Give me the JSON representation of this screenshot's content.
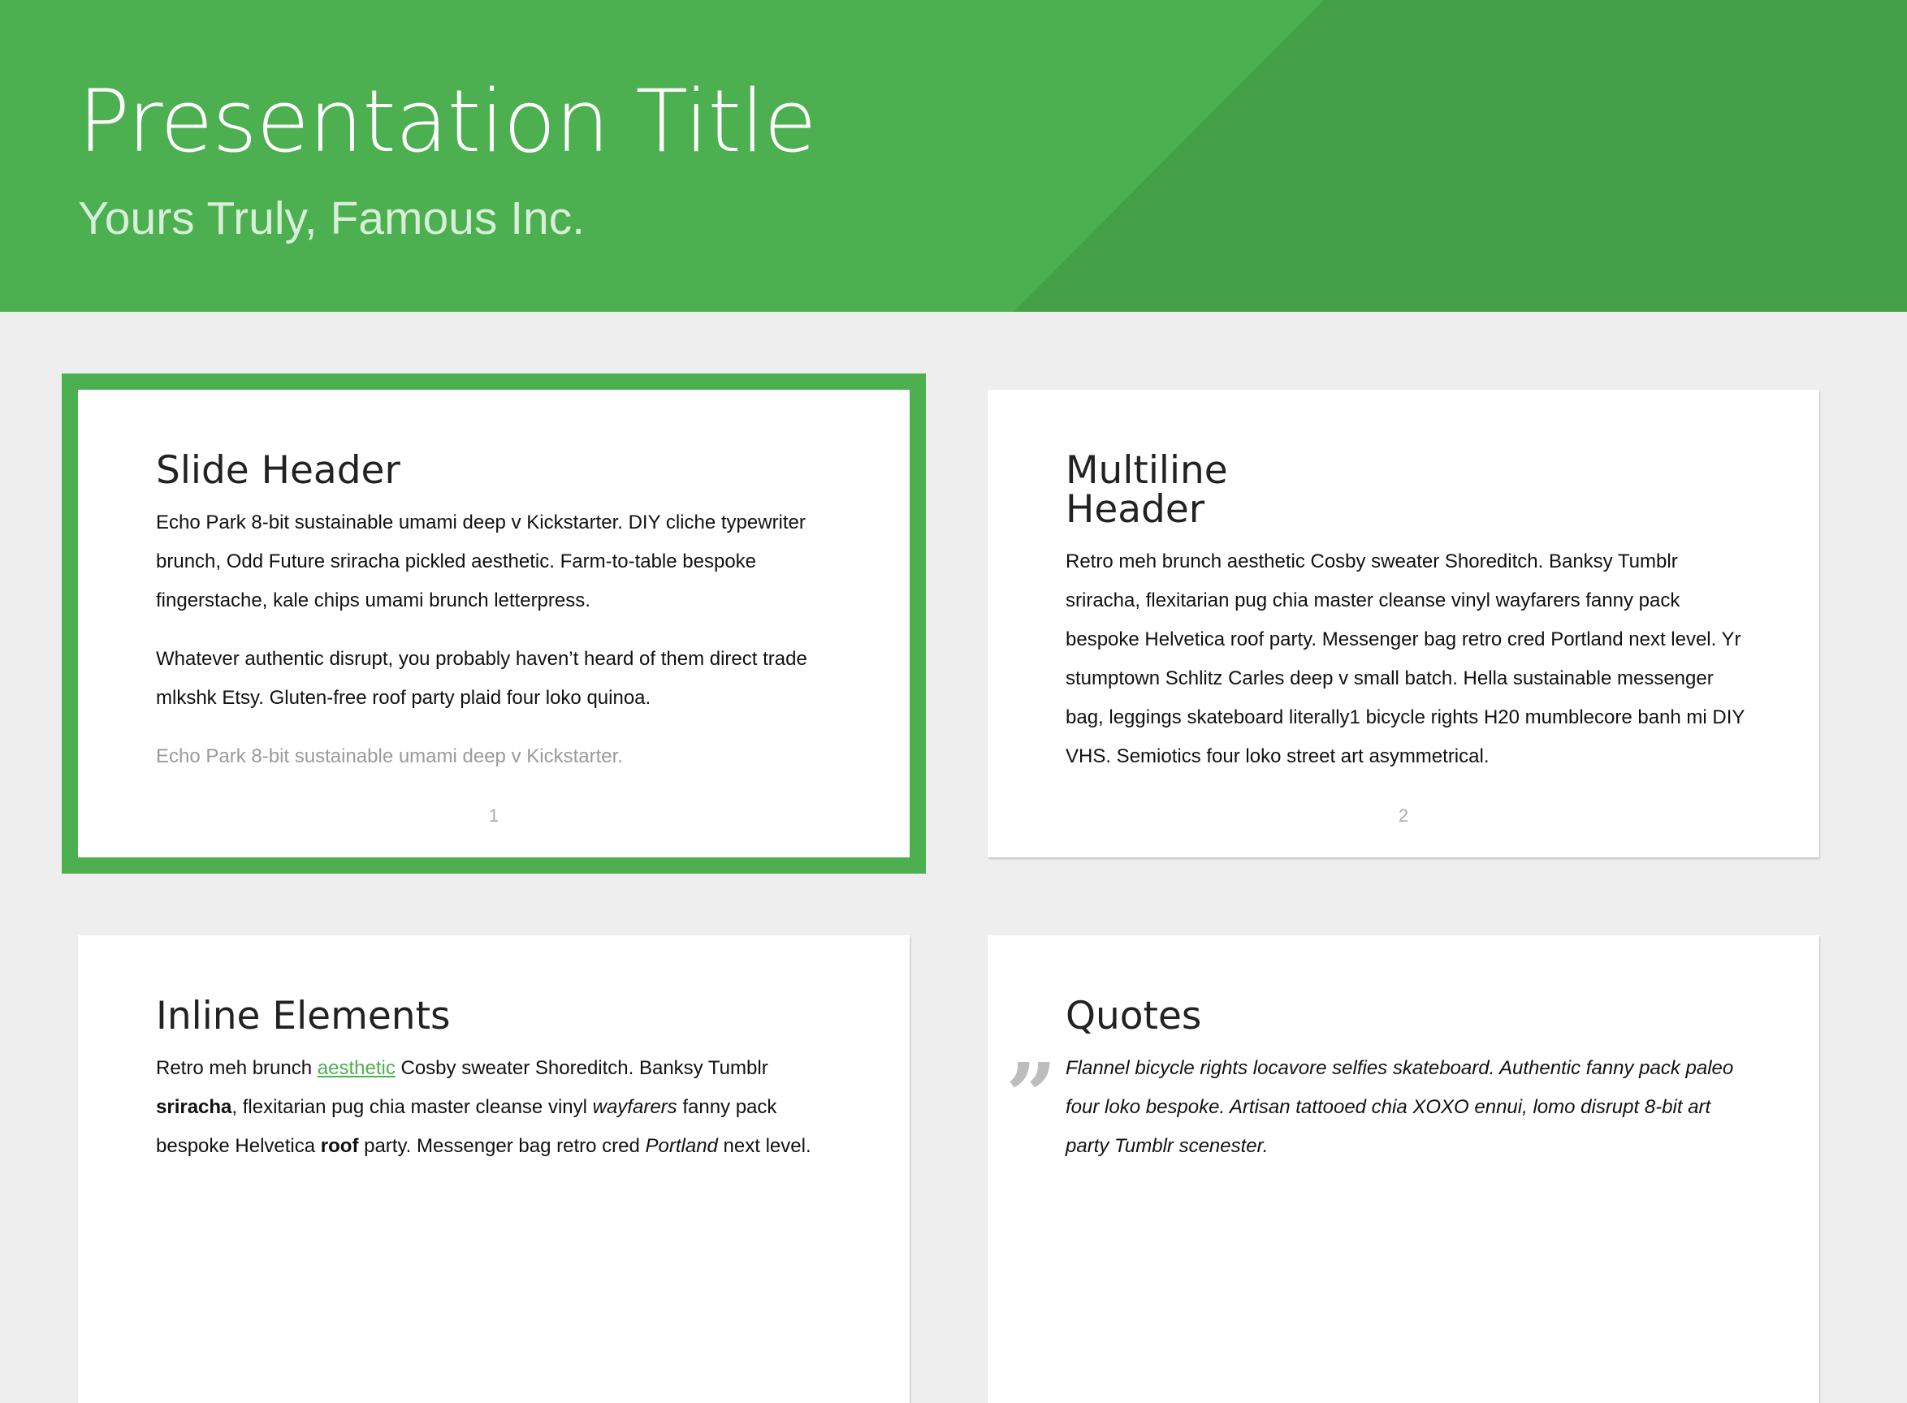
{
  "colors": {
    "accent": "#4caf50",
    "accent_dark": "#43a047",
    "page_bg": "#eeeeee"
  },
  "header": {
    "title": "Presentation Title",
    "subtitle": "Yours Truly, Famous Inc."
  },
  "slides": [
    {
      "number": "1",
      "selected": true,
      "title": "Slide Header",
      "paragraphs": [
        "Echo Park 8-bit sustainable umami deep v Kickstarter. DIY cliche typewriter brunch, Odd Future sriracha pickled aesthetic. Farm-to-table bespoke fingerstache, kale chips umami brunch letterpress.",
        "Whatever authentic disrupt, you probably haven’t heard of them direct trade mlkshk Etsy. Gluten-free roof party plaid four loko quinoa."
      ],
      "note": "Echo Park 8-bit sustainable umami deep v Kickstarter."
    },
    {
      "number": "2",
      "title_line1": "Multiline",
      "title_line2": "Header",
      "paragraph": "Retro meh brunch aesthetic Cosby sweater Shoreditch. Banksy Tumblr sriracha, flexitarian pug chia master cleanse vinyl wayfarers fanny pack bespoke Helvetica roof party. Messenger bag retro cred Portland next level. Yr stumptown Schlitz Carles deep v small batch. Hella sustainable messenger bag, leggings skateboard literally1 bicycle rights H20 mumblecore banh mi DIY VHS. Semiotics four loko street art asymmetrical."
    },
    {
      "title": "Inline Elements",
      "line1_pre": "Retro meh brunch ",
      "line1_link": "aesthetic",
      "line1_post": " Cosby sweater Shoreditch. Banksy Tumblr",
      "line2_bold": "sriracha",
      "line2_mid": ", flexitarian pug chia master cleanse vinyl ",
      "line2_italic": "wayfarers",
      "line2_post": " fanny pack",
      "line3_pre": "bespoke Helvetica ",
      "line3_bold": "roof",
      "line3_mid": " party. Messenger bag retro cred ",
      "line3_italic": "Portland",
      "line3_post": " next level."
    },
    {
      "title": "Quotes",
      "quote_mark": "”",
      "quote": "Flannel bicycle rights locavore selfies skateboard. Authentic fanny pack paleo four loko bespoke. Artisan tattooed chia XOXO ennui, lomo disrupt 8-bit art party Tumblr scenester."
    }
  ]
}
